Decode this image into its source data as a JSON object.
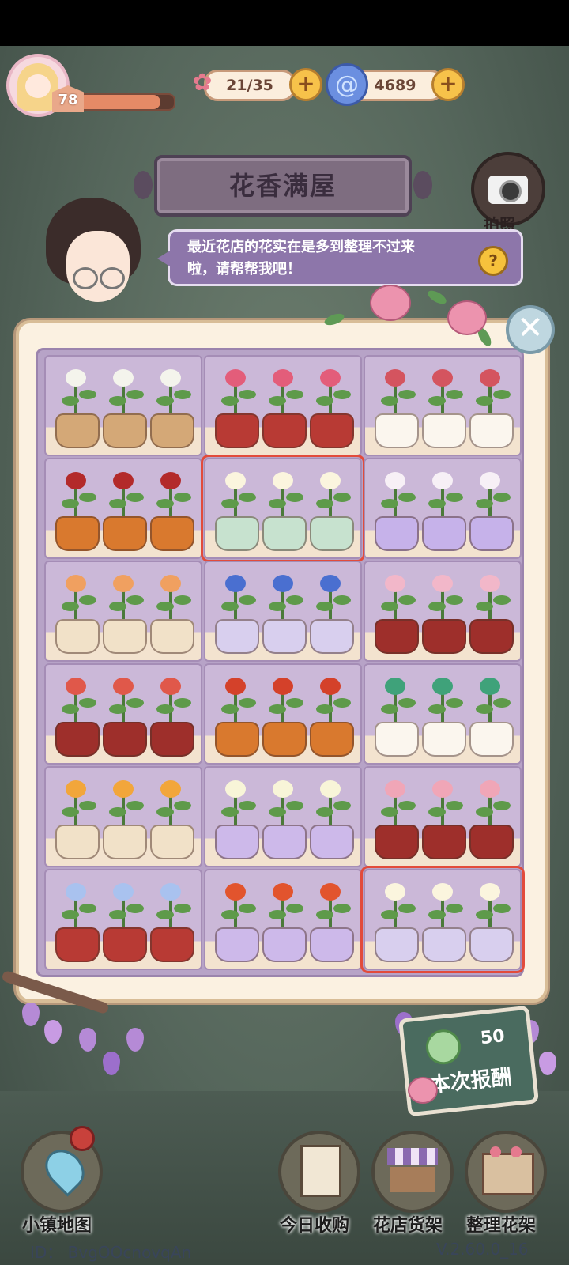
{
  "player": {
    "level": "78",
    "xp_fraction": 0.86
  },
  "resources": {
    "flowers": "21/35",
    "coins": "4689"
  },
  "title": "花香满屋",
  "camera_label": "拍照",
  "dialog": {
    "line1": "最近花店的花实在是多到整理不过来",
    "line2": "啦，请帮帮我吧！"
  },
  "reward": {
    "value": "50",
    "label": "本次报酬"
  },
  "nav": {
    "map": "小镇地图",
    "daily": "今日收购",
    "shop": "花店货架",
    "arrange": "整理花架"
  },
  "footer": {
    "id": "ID： BvgOOcnovqAn",
    "version": "V.2.60.0_16"
  },
  "colors": {
    "selection": "#e24b3b",
    "panel": "#fbf1e1",
    "grid": "#b7a3c7"
  },
  "shelf": [
    [
      {
        "flower": "white snowdrop",
        "bloom": "#f4f4ec",
        "pot": "#d4a877"
      },
      {
        "flower": "pink rose",
        "bloom": "#e35d7a",
        "pot": "#b83a34"
      },
      {
        "flower": "red orchid",
        "bloom": "#d4545f",
        "pot": "#fbf6ee"
      }
    ],
    [
      {
        "flower": "red rose",
        "bloom": "#b32a2a",
        "pot": "#d9792e"
      },
      {
        "flower": "white lily",
        "bloom": "#fbf5de",
        "pot": "#c7e2cf",
        "selected": true
      },
      {
        "flower": "white azalea",
        "bloom": "#f7f0f6",
        "pot": "#c6b2ea"
      }
    ],
    [
      {
        "flower": "orange bouquet",
        "bloom": "#f0a060",
        "pot": "#f1e1c8"
      },
      {
        "flower": "blue daisy",
        "bloom": "#4a6fd0",
        "pot": "#d8cfee"
      },
      {
        "flower": "pink hydrangea",
        "bloom": "#f2b7c9",
        "pot": "#9e2f2b"
      }
    ],
    [
      {
        "flower": "red lily",
        "bloom": "#e0584a",
        "pot": "#9e2f2b"
      },
      {
        "flower": "red bird of paradise",
        "bloom": "#d4412a",
        "pot": "#d9792e"
      },
      {
        "flower": "green orchid",
        "bloom": "#3fa27a",
        "pot": "#fbf6ee"
      }
    ],
    [
      {
        "flower": "orange marigold",
        "bloom": "#f2a63b",
        "pot": "#f1e1c8"
      },
      {
        "flower": "white calla",
        "bloom": "#f8f5d8",
        "pot": "#cdb9ea"
      },
      {
        "flower": "pink carnation",
        "bloom": "#f0a6b7",
        "pot": "#9e2f2b"
      }
    ],
    [
      {
        "flower": "blue rose",
        "bloom": "#a9c2ef",
        "pot": "#b83a34"
      },
      {
        "flower": "orange tiger lily",
        "bloom": "#e2542d",
        "pot": "#cdb9ea"
      },
      {
        "flower": "white lily",
        "bloom": "#fbf5de",
        "pot": "#d8cfee",
        "selected": true
      }
    ]
  ]
}
